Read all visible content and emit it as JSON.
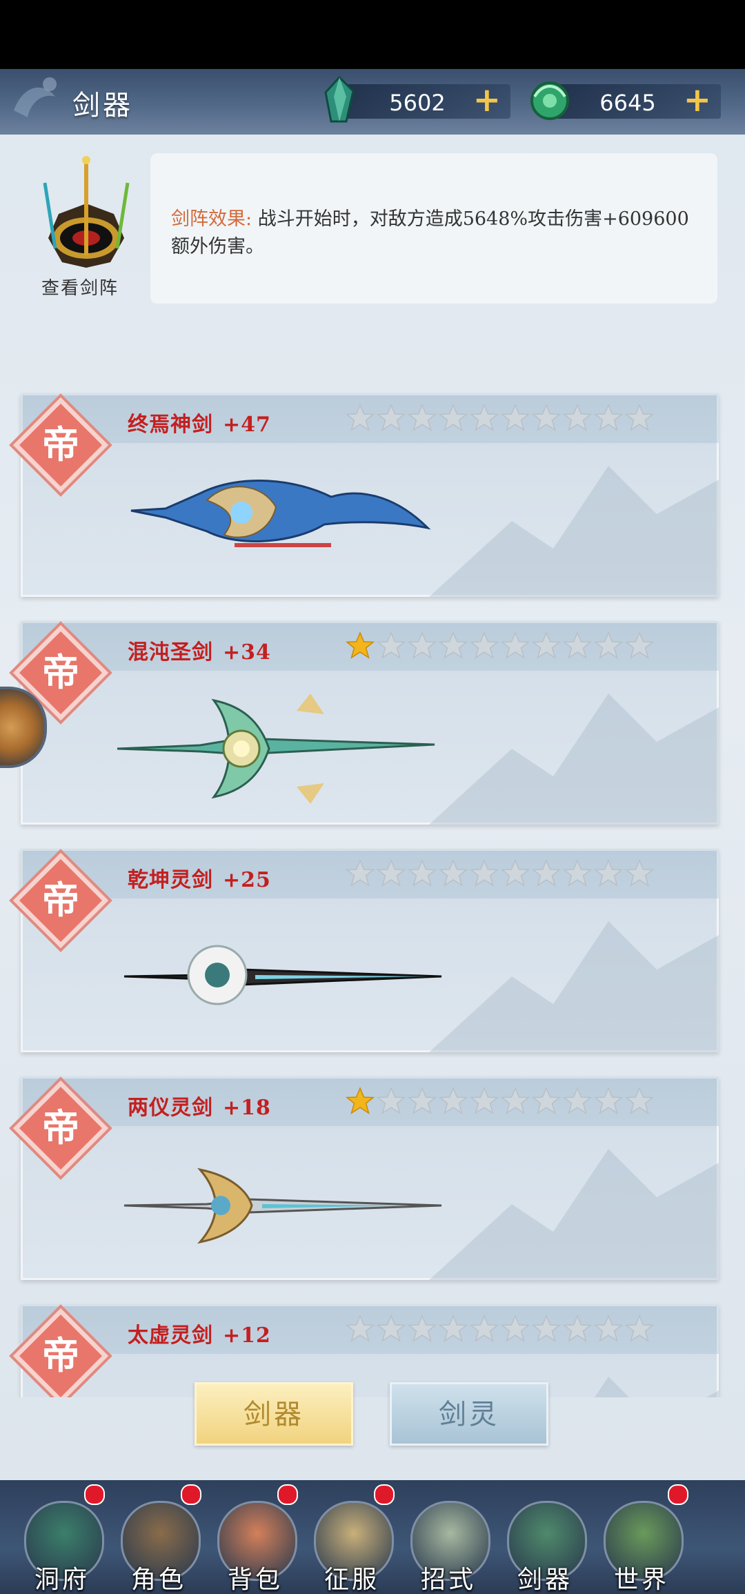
{
  "header": {
    "title": "剑器",
    "resources": [
      {
        "icon": "jade-crystal-icon",
        "value": "5602",
        "add_label": "+"
      },
      {
        "icon": "green-jade-coin-icon",
        "value": "6645",
        "add_label": "+"
      }
    ]
  },
  "formation": {
    "label": "查看剑阵",
    "effect_label": "剑阵效果:",
    "effect_text": "战斗开始时，对敌方造成5648%攻击伤害+609600额外伤害。"
  },
  "swords": [
    {
      "badge": "帝",
      "name": "终焉神剑",
      "level": "+47",
      "stars_filled": 0,
      "stars_total": 10
    },
    {
      "badge": "帝",
      "name": "混沌圣剑",
      "level": "+34",
      "stars_filled": 1,
      "stars_total": 10
    },
    {
      "badge": "帝",
      "name": "乾坤灵剑",
      "level": "+25",
      "stars_filled": 0,
      "stars_total": 10
    },
    {
      "badge": "帝",
      "name": "两仪灵剑",
      "level": "+18",
      "stars_filled": 1,
      "stars_total": 10
    },
    {
      "badge": "帝",
      "name": "太虚灵剑",
      "level": "+12",
      "stars_filled": 0,
      "stars_total": 10
    }
  ],
  "tabs": {
    "active": "剑器",
    "inactive": "剑灵"
  },
  "nav": [
    {
      "label": "洞府",
      "icon": "cave-house-icon",
      "dot": true
    },
    {
      "label": "角色",
      "icon": "character-icon",
      "dot": true
    },
    {
      "label": "背包",
      "icon": "bag-icon",
      "dot": true
    },
    {
      "label": "征服",
      "icon": "crossed-swords-icon",
      "dot": true
    },
    {
      "label": "招式",
      "icon": "scroll-icon",
      "dot": false
    },
    {
      "label": "剑器",
      "icon": "sword-icon",
      "dot": false
    },
    {
      "label": "世界",
      "icon": "world-map-icon",
      "dot": true
    }
  ],
  "colors": {
    "header_bg": "#3a4f6d",
    "sword_name": "#c41f1f",
    "star_filled": "#f2b61c",
    "star_empty": "#cfd6dc",
    "effect_label": "#d36a3a",
    "tab_active": "#f1d37f",
    "tab_inactive": "#a9c3d5",
    "red_dot": "#e0192a"
  }
}
